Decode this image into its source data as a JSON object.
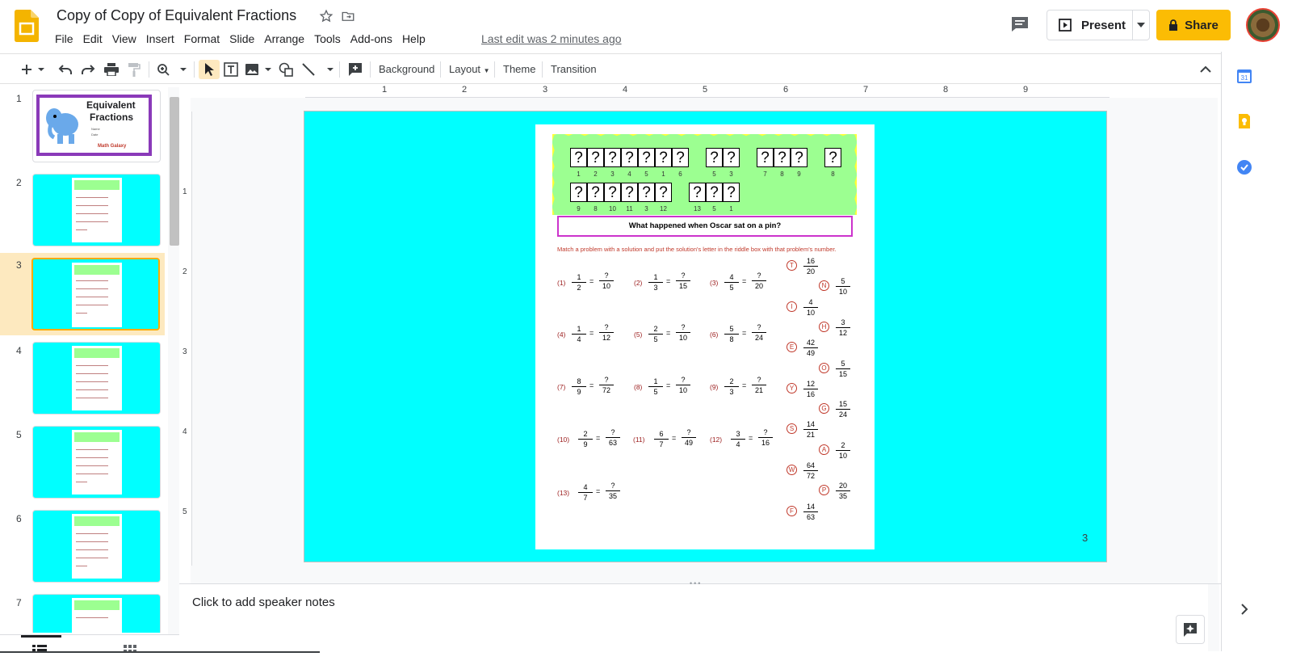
{
  "app": {
    "title": "Copy of Copy of Equivalent Fractions",
    "last_edit": "Last edit was 2 minutes ago",
    "menus": [
      "File",
      "Edit",
      "View",
      "Insert",
      "Format",
      "Slide",
      "Arrange",
      "Tools",
      "Add-ons",
      "Help"
    ],
    "present_label": "Present",
    "share_label": "Share",
    "accent": "#fbbc04"
  },
  "toolbar": {
    "background_label": "Background",
    "layout_label": "Layout",
    "theme_label": "Theme",
    "transition_label": "Transition",
    "icons": [
      "add-icon",
      "undo-icon",
      "redo-icon",
      "print-icon",
      "paint-format-icon",
      "zoom-icon",
      "select-icon",
      "text-box-icon",
      "image-icon",
      "shape-icon",
      "line-icon",
      "comment-add-icon",
      "collapse-icon"
    ]
  },
  "ruler": {
    "horizontal": [
      "1",
      "2",
      "3",
      "4",
      "5",
      "6",
      "7",
      "8",
      "9"
    ],
    "vertical": [
      "1",
      "2",
      "3",
      "4",
      "5"
    ]
  },
  "filmstrip": {
    "slides": [
      {
        "num": "1",
        "title": "Equivalent",
        "title2": "Fractions",
        "name": "Name",
        "date": "Date",
        "brand": "Math Galaxy"
      },
      {
        "num": "2"
      },
      {
        "num": "3",
        "selected": true
      },
      {
        "num": "4"
      },
      {
        "num": "5"
      },
      {
        "num": "6"
      },
      {
        "num": "7"
      }
    ]
  },
  "slide": {
    "page_number": "3",
    "bg_color": "#00ffff",
    "qmark": "?",
    "box_row1_numbers": [
      "1",
      "2",
      "3",
      "4",
      "5",
      "1",
      "6",
      "5",
      "3",
      "7",
      "8",
      "9",
      "8"
    ],
    "box_row2_numbers": [
      "9",
      "8",
      "10",
      "11",
      "3",
      "12",
      "13",
      "5",
      "1"
    ],
    "riddle": "What happened when Oscar sat on a pin?",
    "instructions": "Match a problem with a solution and put the solution's letter in the riddle box with that problem's number.",
    "problems": [
      {
        "label": "(1)",
        "n": "1",
        "d": "2",
        "an": "?",
        "ad": "10"
      },
      {
        "label": "(2)",
        "n": "1",
        "d": "3",
        "an": "?",
        "ad": "15"
      },
      {
        "label": "(3)",
        "n": "4",
        "d": "5",
        "an": "?",
        "ad": "20"
      },
      {
        "label": "(4)",
        "n": "1",
        "d": "4",
        "an": "?",
        "ad": "12"
      },
      {
        "label": "(5)",
        "n": "2",
        "d": "5",
        "an": "?",
        "ad": "10"
      },
      {
        "label": "(6)",
        "n": "5",
        "d": "8",
        "an": "?",
        "ad": "24"
      },
      {
        "label": "(7)",
        "n": "8",
        "d": "9",
        "an": "?",
        "ad": "72"
      },
      {
        "label": "(8)",
        "n": "1",
        "d": "5",
        "an": "?",
        "ad": "10"
      },
      {
        "label": "(9)",
        "n": "2",
        "d": "3",
        "an": "?",
        "ad": "21"
      },
      {
        "label": "(10)",
        "n": "2",
        "d": "9",
        "an": "?",
        "ad": "63"
      },
      {
        "label": "(11)",
        "n": "6",
        "d": "7",
        "an": "?",
        "ad": "49"
      },
      {
        "label": "(12)",
        "n": "3",
        "d": "4",
        "an": "?",
        "ad": "16"
      },
      {
        "label": "(13)",
        "n": "4",
        "d": "7",
        "an": "?",
        "ad": "35"
      }
    ],
    "equals": "=",
    "answers": [
      {
        "letter": "T",
        "n": "16",
        "d": "20"
      },
      {
        "letter": "N",
        "n": "5",
        "d": "10"
      },
      {
        "letter": "I",
        "n": "4",
        "d": "10"
      },
      {
        "letter": "H",
        "n": "3",
        "d": "12"
      },
      {
        "letter": "E",
        "n": "42",
        "d": "49"
      },
      {
        "letter": "O",
        "n": "5",
        "d": "15"
      },
      {
        "letter": "Y",
        "n": "12",
        "d": "16"
      },
      {
        "letter": "G",
        "n": "15",
        "d": "24"
      },
      {
        "letter": "S",
        "n": "14",
        "d": "21"
      },
      {
        "letter": "A",
        "n": "2",
        "d": "10"
      },
      {
        "letter": "W",
        "n": "64",
        "d": "72"
      },
      {
        "letter": "P",
        "n": "20",
        "d": "35"
      },
      {
        "letter": "F",
        "n": "14",
        "d": "63"
      }
    ]
  },
  "notes": {
    "placeholder": "Click to add speaker notes"
  },
  "side_panel": {
    "icons": [
      "calendar-icon",
      "keep-icon",
      "tasks-icon",
      "expand-icon"
    ]
  }
}
